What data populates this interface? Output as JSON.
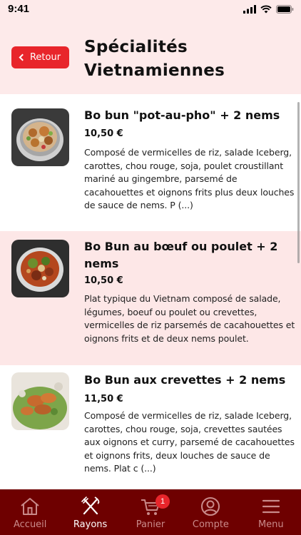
{
  "status_bar": {
    "time": "9:41"
  },
  "header": {
    "back_label": "Retour",
    "title": "Spécialités Vietnamiennes"
  },
  "items": [
    {
      "title": "Bo bun \"pot-au-pho\" + 2 nems",
      "price": "10,50 €",
      "description": "Composé de vermicelles de riz, salade Iceberg, carottes, chou rouge, soja, poulet croustillant mariné au gingembre, parsemé de cacahouettes et oignons frits plus deux louches de sauce de nems. P (...)"
    },
    {
      "title": "Bo Bun au bœuf ou poulet + 2 nems",
      "price": "10,50 €",
      "description": "Plat typique du Vietnam composé de salade, légumes, boeuf ou poulet ou crevettes, vermicelles de riz parsemés de cacahouettes et oignons frits et de deux nems poulet."
    },
    {
      "title": "Bo Bun aux crevettes + 2 nems",
      "price": "11,50 €",
      "description": "Composé de vermicelles de riz, salade Iceberg, carottes, chou rouge, soja, crevettes sautées aux oignons et curry, parsemé de cacahouettes et oignons frits, deux louches de sauce de nems. Plat c (...)"
    }
  ],
  "tabbar": {
    "tabs": [
      {
        "label": "Accueil",
        "icon": "home-icon"
      },
      {
        "label": "Rayons",
        "icon": "fork-knife-icon"
      },
      {
        "label": "Panier",
        "icon": "cart-icon",
        "badge": "1"
      },
      {
        "label": "Compte",
        "icon": "user-icon"
      },
      {
        "label": "Menu",
        "icon": "hamburger-icon"
      }
    ]
  },
  "colors": {
    "accent": "#e8252b",
    "tabbar": "#6e0000",
    "header_bg": "#fdeaea",
    "alt_row": "#fde7e7"
  }
}
